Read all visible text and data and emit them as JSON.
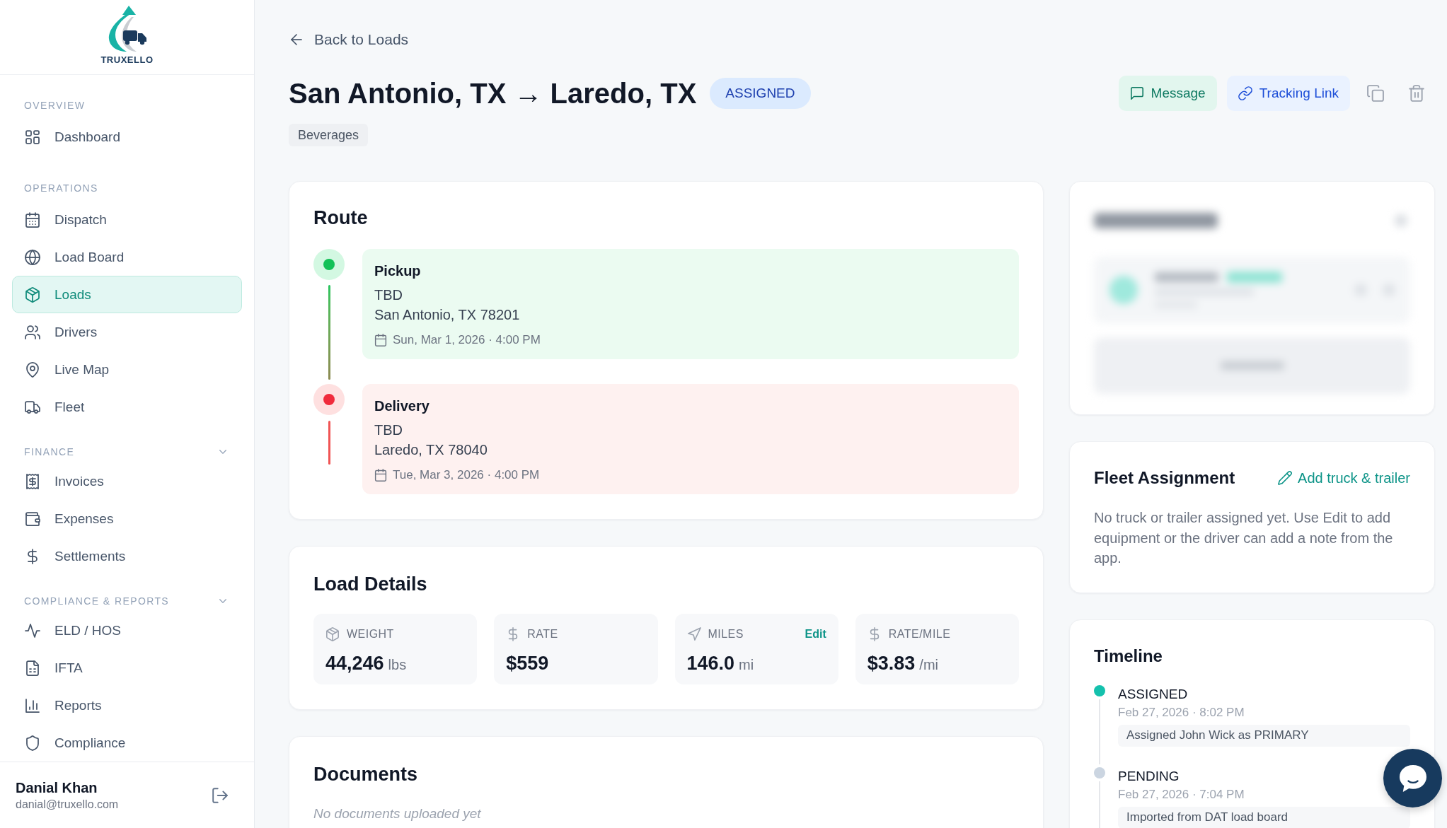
{
  "sidebar": {
    "logo": {
      "text": "TRUXELLO"
    },
    "sections": [
      {
        "title": "OVERVIEW",
        "items": [
          {
            "label": "Dashboard",
            "selected": false
          }
        ]
      },
      {
        "title": "OPERATIONS",
        "items": [
          {
            "label": "Dispatch",
            "selected": false
          },
          {
            "label": "Load Board",
            "selected": false
          },
          {
            "label": "Loads",
            "selected": true
          },
          {
            "label": "Drivers",
            "selected": false
          },
          {
            "label": "Live Map",
            "selected": false
          },
          {
            "label": "Fleet",
            "selected": false
          }
        ]
      },
      {
        "title": "FINANCE",
        "expanded": true,
        "items": [
          {
            "label": "Invoices",
            "selected": false
          },
          {
            "label": "Expenses",
            "selected": false
          },
          {
            "label": "Settlements",
            "selected": false
          }
        ]
      },
      {
        "title": "COMPLIANCE & REPORTS",
        "expanded": true,
        "items": [
          {
            "label": "ELD / HOS",
            "selected": false
          },
          {
            "label": "IFTA",
            "selected": false
          },
          {
            "label": "Reports",
            "selected": false
          },
          {
            "label": "Compliance",
            "selected": false
          }
        ]
      }
    ],
    "user": {
      "name": "Danial Khan",
      "email": "danial@truxello.com"
    }
  },
  "header": {
    "back_link": "Back to Loads",
    "title": "San Antonio, TX → Laredo, TX",
    "status": "ASSIGNED",
    "tags": [
      "Beverages"
    ],
    "actions": [
      {
        "kind": "message",
        "label": "Message"
      },
      {
        "kind": "tracking",
        "label": "Tracking Link"
      },
      {
        "kind": "copy"
      },
      {
        "kind": "delete"
      }
    ]
  },
  "route": {
    "title": "Route",
    "stops": [
      {
        "kind": "pickup",
        "label": "Pickup",
        "name": "TBD",
        "address": "San Antonio, TX 78201",
        "datetime": "Sun, Mar 1, 2026 · 4:00 PM"
      },
      {
        "kind": "delivery",
        "label": "Delivery",
        "name": "TBD",
        "address": "Laredo, TX 78040",
        "datetime": "Tue, Mar 3, 2026 · 4:00 PM"
      }
    ]
  },
  "load_details": {
    "title": "Load Details",
    "stats": [
      {
        "label": "WEIGHT",
        "value": "44,246",
        "unit": "lbs"
      },
      {
        "label": "RATE",
        "value": "$559"
      },
      {
        "label": "MILES",
        "value": "146.0",
        "unit": "mi",
        "action": "Edit"
      },
      {
        "label": "RATE/MILE",
        "value": "$3.83",
        "unit": "/mi"
      }
    ]
  },
  "documents": {
    "title": "Documents",
    "empty_text": "No documents uploaded yet"
  },
  "assigned_drivers": {
    "blurred": true
  },
  "fleet_assignment": {
    "title": "Fleet Assignment",
    "action": "Add truck & trailer",
    "text": "No truck or trailer assigned yet. Use Edit to add equipment or the driver can add a note from the app."
  },
  "timeline": {
    "title": "Timeline",
    "events": [
      {
        "status": "ASSIGNED",
        "time": "Feb 27, 2026 · 8:02 PM",
        "note": "Assigned John Wick as PRIMARY",
        "color": "#14c1ad"
      },
      {
        "status": "PENDING",
        "time": "Feb 27, 2026 · 7:04 PM",
        "note": "Imported from DAT load board",
        "color": "#cbd5e1"
      }
    ]
  },
  "chat_launcher": {
    "visible": true
  }
}
